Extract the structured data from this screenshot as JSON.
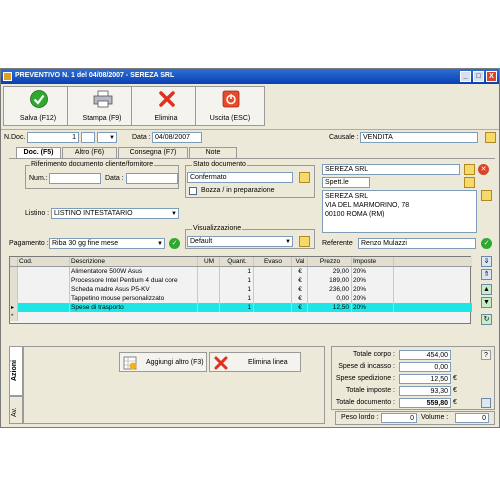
{
  "window": {
    "title": "PREVENTIVO N. 1  del 04/08/2007 - SEREZA SRL",
    "controls": [
      "_",
      "□",
      "X"
    ]
  },
  "toolbar": {
    "save": "Salva (F12)",
    "print": "Stampa (F9)",
    "delete": "Elimina",
    "exit": "Uscita (ESC)"
  },
  "header": {
    "ndoc_label": "N.Doc.",
    "ndoc_value": "1",
    "data_label": "Data :",
    "data_value": "04/08/2007",
    "causale_label": "Causale :",
    "causale_value": "VENDITA"
  },
  "tabs": [
    "Doc. (F5)",
    "Altro (F6)",
    "Consegna (F7)",
    "Note"
  ],
  "rif": {
    "legend": "Riferimento documento cliente/fornitore",
    "num_label": "Num.:",
    "data_label": "Data :"
  },
  "stato": {
    "legend": "Stato documento",
    "value": "Confermato",
    "bozza_label": "Bozza / in preparazione"
  },
  "cliente": {
    "name": "SEREZA SRL",
    "spett": "Spett.le",
    "address": [
      "SEREZA SRL",
      "VIA DEL MARMORINO, 78",
      "00100 ROMA (RM)"
    ],
    "referente_label": "Referente",
    "referente_value": "Renzo Mulazzi"
  },
  "listino": {
    "label": "Listino :",
    "value": "LISTINO INTESTATARIO"
  },
  "pagamento": {
    "label": "Pagamento :",
    "value": "Riba 30 gg fine mese"
  },
  "visualizzazione": {
    "legend": "Visualizzazione",
    "value": "Default"
  },
  "grid": {
    "columns": [
      "Cod.",
      "Descrizione",
      "UM",
      "Quant.",
      "Evaso",
      "Val",
      "Prezzo",
      "Imposte"
    ],
    "rows": [
      {
        "cod": "",
        "desc": "Alimentatore 500W Asus",
        "um": "",
        "qty": "1",
        "evaso": "",
        "val": "€",
        "price": "29,00",
        "tax": "20%"
      },
      {
        "cod": "",
        "desc": "Processore Intel Pentium 4 dual core",
        "um": "",
        "qty": "1",
        "evaso": "",
        "val": "€",
        "price": "189,00",
        "tax": "20%"
      },
      {
        "cod": "",
        "desc": "Scheda madre Asus P5-KV",
        "um": "",
        "qty": "1",
        "evaso": "",
        "val": "€",
        "price": "236,00",
        "tax": "20%"
      },
      {
        "cod": "",
        "desc": "Tappetino mouse personalizzato",
        "um": "",
        "qty": "1",
        "evaso": "",
        "val": "€",
        "price": "0,00",
        "tax": "20%"
      },
      {
        "cod": "",
        "desc": "Spese di trasporto",
        "um": "",
        "qty": "1",
        "evaso": "",
        "val": "€",
        "price": "12,50",
        "tax": "20%"
      }
    ]
  },
  "side_tabs": [
    "Azioni",
    "Av."
  ],
  "actions": {
    "add": "Aggiungi altro (F3)",
    "remove": "Elimina linea"
  },
  "totals": {
    "corpo_label": "Totale corpo :",
    "corpo": "454,00",
    "corpo_q": "?",
    "incasso_label": "Spese di incasso :",
    "incasso": "0,00",
    "spedizione_label": "Spese spedizione :",
    "spedizione": "12,50",
    "spedizione_cur": "€",
    "imposte_label": "Totale imposte :",
    "imposte": "93,30",
    "imposte_cur": "€",
    "documento_label": "Totale documento :",
    "documento": "559,80",
    "documento_cur": "€",
    "peso_label": "Peso lordo :",
    "peso": "0",
    "volume_label": "Volume :",
    "volume": "0"
  },
  "colors": {
    "title_bar": "#0a3fb0",
    "selected_row": "#1ee6e6",
    "window_bg": "#ece9d8"
  }
}
